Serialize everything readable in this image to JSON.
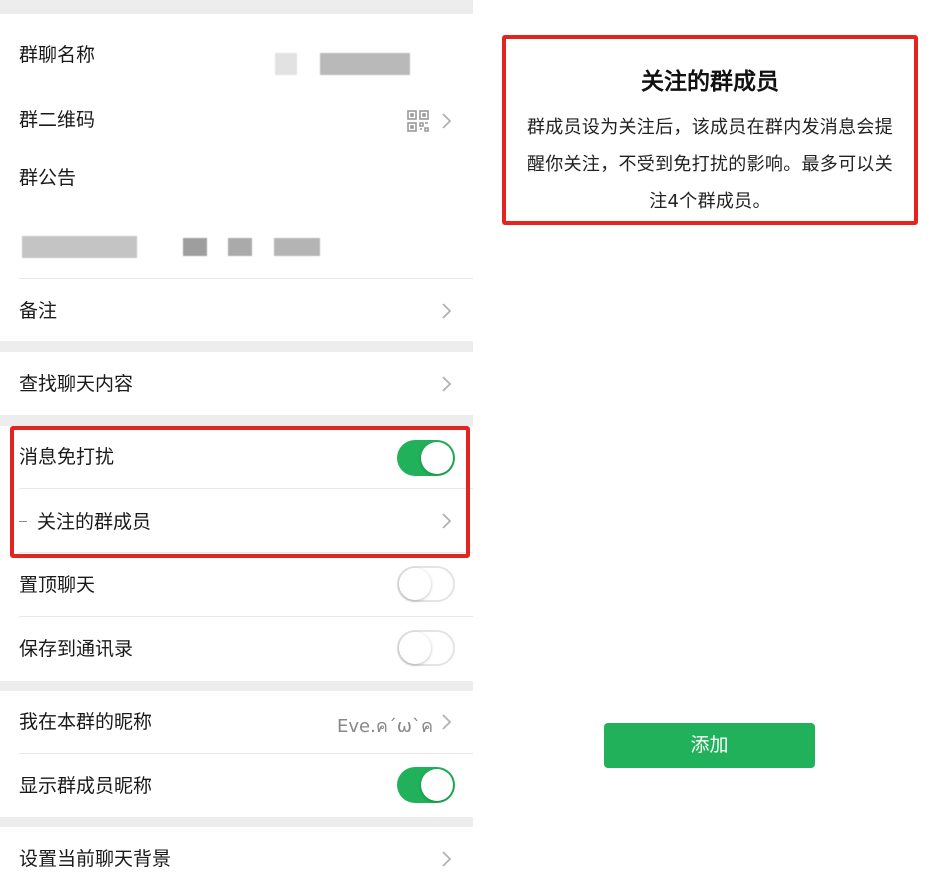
{
  "settings": {
    "group_name_label": "群聊名称",
    "qr_code_label": "群二维码",
    "announcement_label": "群公告",
    "remark_label": "备注",
    "search_history_label": "查找聊天内容",
    "mute_label": "消息免打扰",
    "mute_on": true,
    "starred_members_label": "关注的群成员",
    "sticky_label": "置顶聊天",
    "sticky_on": false,
    "save_contacts_label": "保存到通讯录",
    "save_contacts_on": false,
    "my_nickname_label": "我在本群的昵称",
    "my_nickname_value": "Eve.ค´ω`ค",
    "show_nicknames_label": "显示群成员昵称",
    "show_nicknames_on": true,
    "chat_background_label": "设置当前聊天背景"
  },
  "info": {
    "title": "关注的群成员",
    "lines": [
      "群成员设为关注后，该成员在群内发消息会提",
      "醒你关注，不受到免打扰的影响。最多可以关",
      "注4个群成员。"
    ],
    "add_button": "添加"
  },
  "colors": {
    "accent_green": "#20b15a",
    "highlight_red": "#e5231f",
    "panel_bg": "#ededed"
  },
  "icons": {
    "chevron": "chevron-right-icon",
    "qr": "qr-code-icon"
  }
}
